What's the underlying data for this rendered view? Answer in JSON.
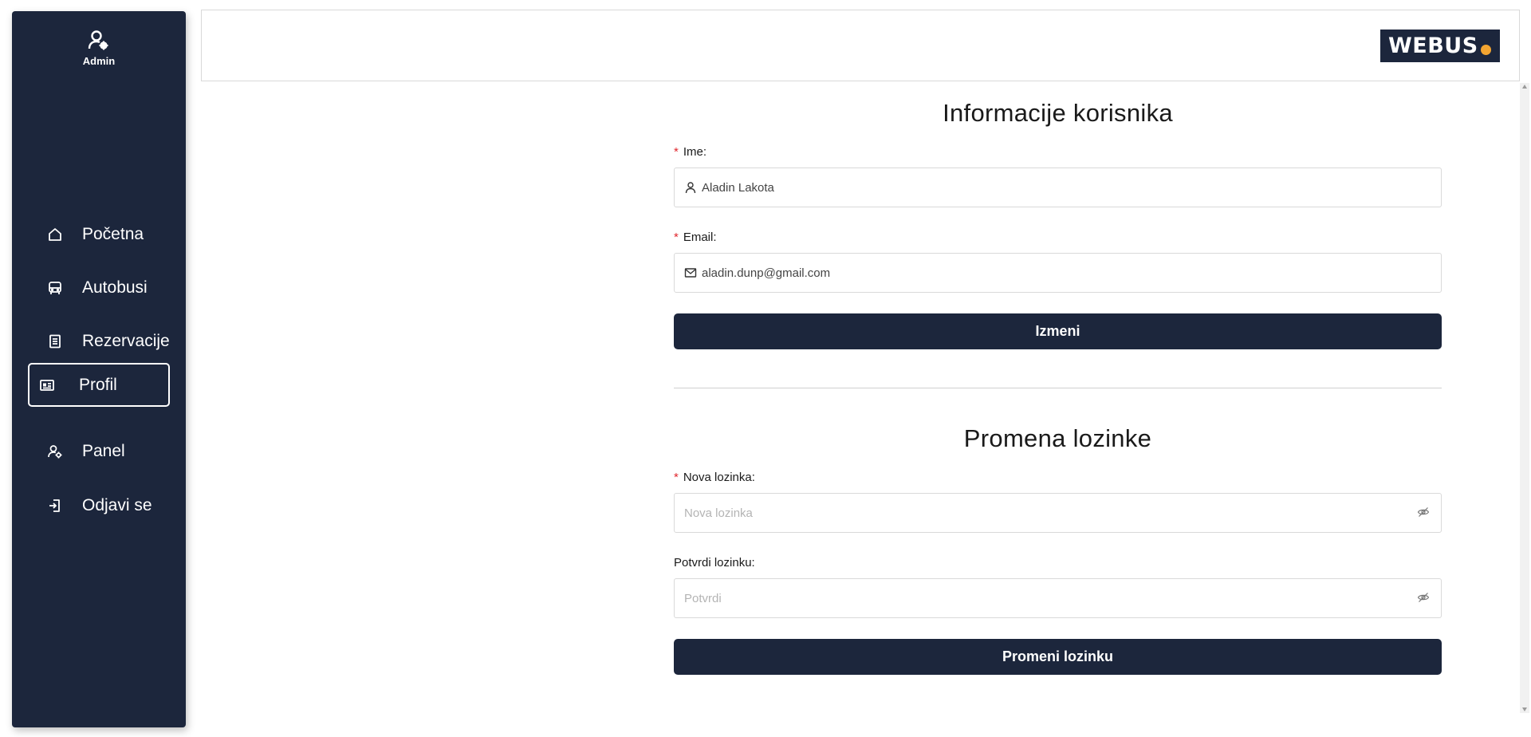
{
  "sidebar": {
    "user_role": "Admin",
    "items": [
      {
        "label": "Početna",
        "icon": "home-icon"
      },
      {
        "label": "Autobusi",
        "icon": "bus-icon"
      },
      {
        "label": "Rezervacije",
        "icon": "document-icon"
      },
      {
        "label": "Profil",
        "icon": "id-card-icon",
        "active": true
      },
      {
        "label": "Panel",
        "icon": "user-gear-icon"
      },
      {
        "label": "Odjavi se",
        "icon": "logout-icon"
      }
    ]
  },
  "header": {
    "logo_text": "WEBUS"
  },
  "user_info": {
    "title": "Informacije korisnika",
    "name_label": "Ime:",
    "name_value": "Aladin Lakota",
    "email_label": "Email:",
    "email_value": "aladin.dunp@gmail.com",
    "submit_label": "Izmeni"
  },
  "password_change": {
    "title": "Promena lozinke",
    "new_label": "Nova lozinka:",
    "new_placeholder": "Nova lozinka",
    "confirm_label": "Potvrdi lozinku:",
    "confirm_placeholder": "Potvrdi",
    "submit_label": "Promeni lozinku"
  },
  "colors": {
    "primary": "#1c263c",
    "required_marker": "#e0262d",
    "logo_accent": "#f3a531"
  }
}
